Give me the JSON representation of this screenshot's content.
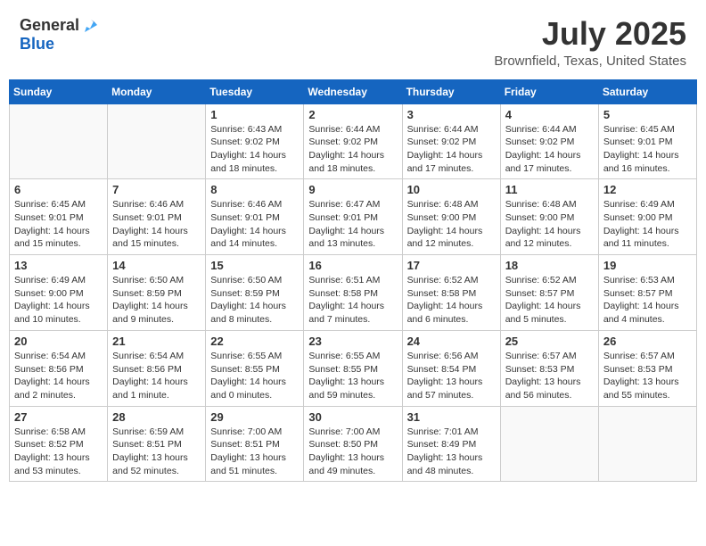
{
  "header": {
    "logo_general": "General",
    "logo_blue": "Blue",
    "title": "July 2025",
    "subtitle": "Brownfield, Texas, United States"
  },
  "weekdays": [
    "Sunday",
    "Monday",
    "Tuesday",
    "Wednesday",
    "Thursday",
    "Friday",
    "Saturday"
  ],
  "weeks": [
    [
      {
        "day": "",
        "info": ""
      },
      {
        "day": "",
        "info": ""
      },
      {
        "day": "1",
        "info": "Sunrise: 6:43 AM\nSunset: 9:02 PM\nDaylight: 14 hours and 18 minutes."
      },
      {
        "day": "2",
        "info": "Sunrise: 6:44 AM\nSunset: 9:02 PM\nDaylight: 14 hours and 18 minutes."
      },
      {
        "day": "3",
        "info": "Sunrise: 6:44 AM\nSunset: 9:02 PM\nDaylight: 14 hours and 17 minutes."
      },
      {
        "day": "4",
        "info": "Sunrise: 6:44 AM\nSunset: 9:02 PM\nDaylight: 14 hours and 17 minutes."
      },
      {
        "day": "5",
        "info": "Sunrise: 6:45 AM\nSunset: 9:01 PM\nDaylight: 14 hours and 16 minutes."
      }
    ],
    [
      {
        "day": "6",
        "info": "Sunrise: 6:45 AM\nSunset: 9:01 PM\nDaylight: 14 hours and 15 minutes."
      },
      {
        "day": "7",
        "info": "Sunrise: 6:46 AM\nSunset: 9:01 PM\nDaylight: 14 hours and 15 minutes."
      },
      {
        "day": "8",
        "info": "Sunrise: 6:46 AM\nSunset: 9:01 PM\nDaylight: 14 hours and 14 minutes."
      },
      {
        "day": "9",
        "info": "Sunrise: 6:47 AM\nSunset: 9:01 PM\nDaylight: 14 hours and 13 minutes."
      },
      {
        "day": "10",
        "info": "Sunrise: 6:48 AM\nSunset: 9:00 PM\nDaylight: 14 hours and 12 minutes."
      },
      {
        "day": "11",
        "info": "Sunrise: 6:48 AM\nSunset: 9:00 PM\nDaylight: 14 hours and 12 minutes."
      },
      {
        "day": "12",
        "info": "Sunrise: 6:49 AM\nSunset: 9:00 PM\nDaylight: 14 hours and 11 minutes."
      }
    ],
    [
      {
        "day": "13",
        "info": "Sunrise: 6:49 AM\nSunset: 9:00 PM\nDaylight: 14 hours and 10 minutes."
      },
      {
        "day": "14",
        "info": "Sunrise: 6:50 AM\nSunset: 8:59 PM\nDaylight: 14 hours and 9 minutes."
      },
      {
        "day": "15",
        "info": "Sunrise: 6:50 AM\nSunset: 8:59 PM\nDaylight: 14 hours and 8 minutes."
      },
      {
        "day": "16",
        "info": "Sunrise: 6:51 AM\nSunset: 8:58 PM\nDaylight: 14 hours and 7 minutes."
      },
      {
        "day": "17",
        "info": "Sunrise: 6:52 AM\nSunset: 8:58 PM\nDaylight: 14 hours and 6 minutes."
      },
      {
        "day": "18",
        "info": "Sunrise: 6:52 AM\nSunset: 8:57 PM\nDaylight: 14 hours and 5 minutes."
      },
      {
        "day": "19",
        "info": "Sunrise: 6:53 AM\nSunset: 8:57 PM\nDaylight: 14 hours and 4 minutes."
      }
    ],
    [
      {
        "day": "20",
        "info": "Sunrise: 6:54 AM\nSunset: 8:56 PM\nDaylight: 14 hours and 2 minutes."
      },
      {
        "day": "21",
        "info": "Sunrise: 6:54 AM\nSunset: 8:56 PM\nDaylight: 14 hours and 1 minute."
      },
      {
        "day": "22",
        "info": "Sunrise: 6:55 AM\nSunset: 8:55 PM\nDaylight: 14 hours and 0 minutes."
      },
      {
        "day": "23",
        "info": "Sunrise: 6:55 AM\nSunset: 8:55 PM\nDaylight: 13 hours and 59 minutes."
      },
      {
        "day": "24",
        "info": "Sunrise: 6:56 AM\nSunset: 8:54 PM\nDaylight: 13 hours and 57 minutes."
      },
      {
        "day": "25",
        "info": "Sunrise: 6:57 AM\nSunset: 8:53 PM\nDaylight: 13 hours and 56 minutes."
      },
      {
        "day": "26",
        "info": "Sunrise: 6:57 AM\nSunset: 8:53 PM\nDaylight: 13 hours and 55 minutes."
      }
    ],
    [
      {
        "day": "27",
        "info": "Sunrise: 6:58 AM\nSunset: 8:52 PM\nDaylight: 13 hours and 53 minutes."
      },
      {
        "day": "28",
        "info": "Sunrise: 6:59 AM\nSunset: 8:51 PM\nDaylight: 13 hours and 52 minutes."
      },
      {
        "day": "29",
        "info": "Sunrise: 7:00 AM\nSunset: 8:51 PM\nDaylight: 13 hours and 51 minutes."
      },
      {
        "day": "30",
        "info": "Sunrise: 7:00 AM\nSunset: 8:50 PM\nDaylight: 13 hours and 49 minutes."
      },
      {
        "day": "31",
        "info": "Sunrise: 7:01 AM\nSunset: 8:49 PM\nDaylight: 13 hours and 48 minutes."
      },
      {
        "day": "",
        "info": ""
      },
      {
        "day": "",
        "info": ""
      }
    ]
  ]
}
